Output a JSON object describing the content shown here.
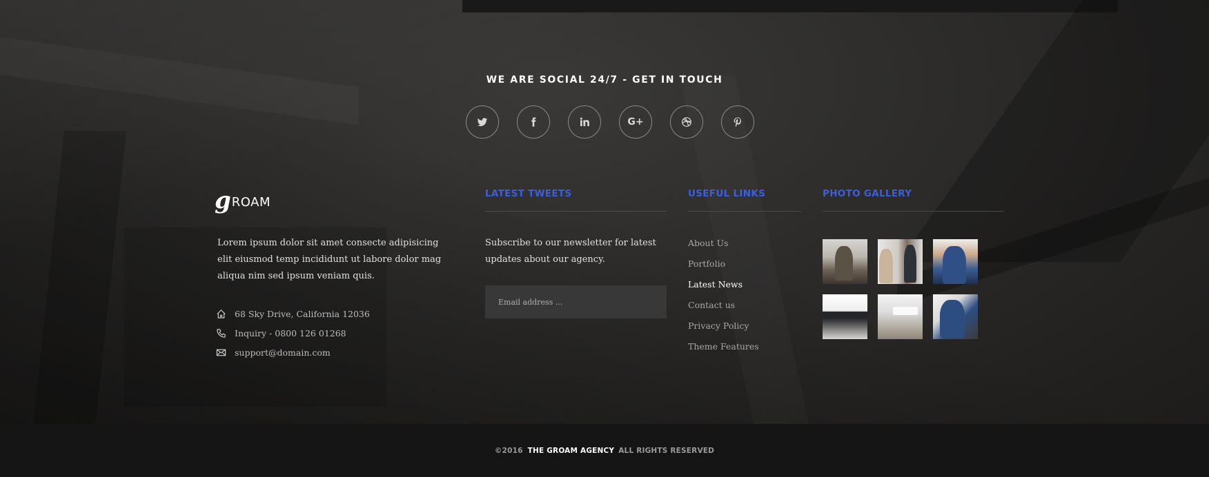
{
  "social": {
    "title": "WE ARE SOCIAL 24/7 - GET IN TOUCH",
    "icons": [
      {
        "name": "twitter-icon",
        "glyph": "twitter"
      },
      {
        "name": "facebook-icon",
        "glyph": "f"
      },
      {
        "name": "linkedin-icon",
        "glyph": "in"
      },
      {
        "name": "google-plus-icon",
        "glyph": "G+"
      },
      {
        "name": "dribbble-icon",
        "glyph": "dribbble"
      },
      {
        "name": "pinterest-icon",
        "glyph": "P"
      }
    ]
  },
  "brand": {
    "logo_mark": "g",
    "logo_text": "ROAM",
    "about": "Lorem ipsum dolor sit amet consecte adipisicing elit eiusmod temp incididunt ut labore dolor mag aliqua nim sed ipsum veniam quis.",
    "contacts": [
      {
        "icon": "home-icon",
        "text": "68 Sky Drive, California  12036"
      },
      {
        "icon": "phone-icon",
        "text": "Inquiry - 0800 126 01268"
      },
      {
        "icon": "mail-icon",
        "text": "support@domain.com"
      }
    ]
  },
  "tweets": {
    "title": "LATEST TWEETS",
    "text": "Subscribe to our newsletter for latest updates about our agency.",
    "email_placeholder": "Email address ..."
  },
  "links": {
    "title": "USEFUL LINKS",
    "items": [
      "About Us",
      "Portfolio",
      "Latest News",
      "Contact us",
      "Privacy Policy",
      "Theme Features"
    ],
    "active_index": 2
  },
  "gallery": {
    "title": "PHOTO GALLERY",
    "photos": [
      "photo-1",
      "photo-2",
      "photo-3",
      "photo-4",
      "photo-5",
      "photo-6"
    ]
  },
  "footer": {
    "copy": "©2016",
    "agency": "THE GROAM AGENCY",
    "rights": "ALL RIGHTS RESERVED"
  },
  "colors": {
    "accent": "#3a5fe0",
    "footer_bg": "#151515"
  }
}
